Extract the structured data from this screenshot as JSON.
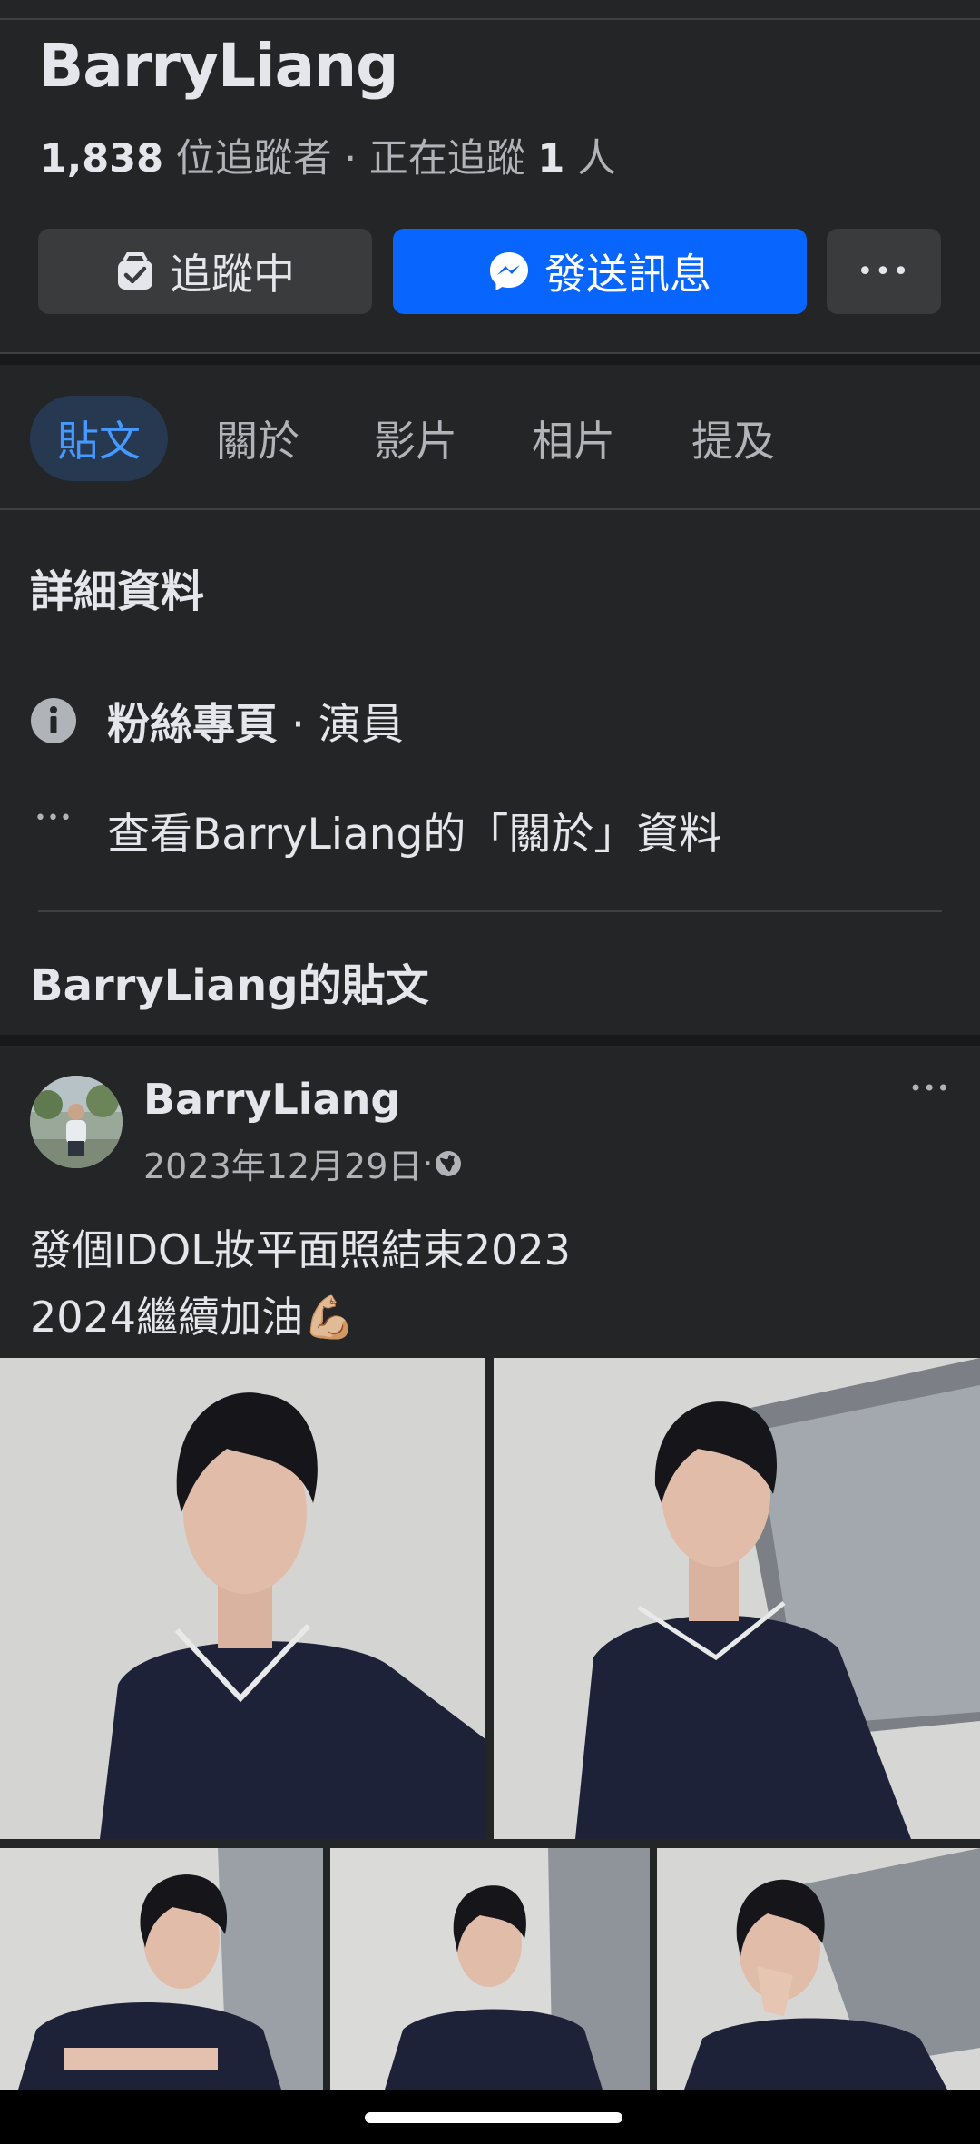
{
  "profile": {
    "name": "BarryLiang",
    "followers_count": "1,838",
    "followers_label": " 位追蹤者 · 正在追蹤 ",
    "following_count": "1",
    "following_suffix": " 人"
  },
  "actions": {
    "following_label": "追蹤中",
    "message_label": "發送訊息",
    "more_label": "•••"
  },
  "tabs": [
    {
      "label": "貼文",
      "active": true
    },
    {
      "label": "關於",
      "active": false
    },
    {
      "label": "影片",
      "active": false
    },
    {
      "label": "相片",
      "active": false
    },
    {
      "label": "提及",
      "active": false
    }
  ],
  "details": {
    "title": "詳細資料",
    "category_bold": "粉絲專頁",
    "category_rest": " · 演員",
    "see_about": "查看BarryLiang的「關於」資料",
    "more_dots": "•••"
  },
  "posts_section": {
    "title": "BarryLiang的貼文"
  },
  "post": {
    "author": "BarryLiang",
    "date": "2023年12月29日",
    "meta_sep": " · ",
    "more": "•••",
    "line1": "發個IDOL妝平面照結束2023",
    "line2": "2024繼續加油💪🏼"
  },
  "colors": {
    "background": "#242526",
    "accent_blue": "#0866ff",
    "active_tab_bg": "#263951",
    "active_tab_text": "#4599ff"
  },
  "icons": {
    "following": "check-badge-icon",
    "message": "messenger-icon",
    "info": "info-icon",
    "globe": "globe-icon"
  }
}
